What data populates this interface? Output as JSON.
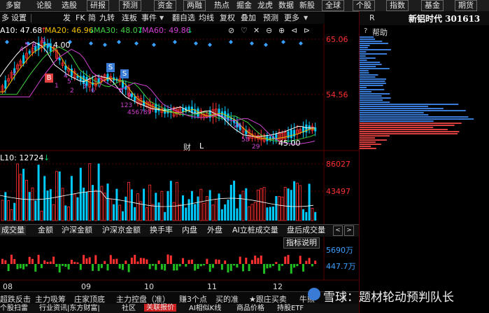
{
  "topbar": {
    "items": [
      "多窗",
      "论股",
      "选股"
    ],
    "boxed_items": [
      "研报",
      "预测",
      "资金",
      "两融",
      "热点",
      "掘金",
      "龙虎",
      "数据",
      "新股",
      "全球",
      "个股",
      "指数",
      "基金",
      "期货"
    ]
  },
  "toolbar": {
    "items": [
      "多",
      "设置",
      "发",
      "FK",
      "简",
      "九转",
      "连板",
      "事件"
    ],
    "items_right": [
      "翻自选",
      "均线",
      "复权",
      "叠加",
      "预测",
      "更多"
    ],
    "icons": [
      "dropdown-arrow-icon",
      "no-entry-icon",
      "heart-icon",
      "x-icon",
      "zoom-out-icon",
      "zoom-in-icon",
      "left-arrow-icon",
      "right-arrow-icon"
    ]
  },
  "ma_legend": [
    {
      "label": "A10: 47.68",
      "color": "#ffffff",
      "arrow": "↑"
    },
    {
      "label": "MA20: 46.96",
      "color": "#f0c000",
      "arrow": "↓"
    },
    {
      "label": "MA30: 48.07",
      "color": "#40d040",
      "arrow": "↓"
    },
    {
      "label": "MA60: 49.86",
      "color": "#d040d0",
      "arrow": "↓"
    }
  ],
  "price_axis": [
    "65.06",
    "54.56"
  ],
  "annotations": {
    "high_price": "4.00",
    "low_price": "45.00",
    "badge_b": "B",
    "badge_s1": "S",
    "badge_s2": "S",
    "cai": "财",
    "l_mark": "L",
    "seq_labels": [
      "4",
      "5",
      "8",
      "9",
      "2",
      "4",
      "5",
      "1",
      "2",
      "3",
      "6",
      "7",
      "8",
      "9",
      "123",
      "456789",
      "58",
      "29",
      "26"
    ]
  },
  "volume": {
    "label": "L10: 12724",
    "label_arrow": "↓",
    "axis": [
      "86027",
      "43497"
    ]
  },
  "indicator_tabs": [
    "成交量",
    "金额",
    "沪深金额",
    "沪深京金额",
    "换手率",
    "内盘",
    "外盘",
    "AI立桩成交量",
    "盘后成交量"
  ],
  "indicator_help": "指标说明",
  "flow_axis": [
    "5690万",
    "447.7万"
  ],
  "months": [
    "08",
    "09",
    "10",
    "11",
    "12"
  ],
  "bottom_tabs": [
    "个股扫雷",
    "行业资讯|东方财富|",
    "社区",
    "关联报价",
    "AI相似K线",
    "商品价格",
    "持股ETF"
  ],
  "bottom_tabs_left": [
    "超跌反击",
    "主力吸筹",
    "庄家顶底",
    "主力控盘（准）",
    "赚3个点",
    "买的准",
    "★跟庄买卖",
    "牛熊"
  ],
  "right_panel": {
    "r_label": "R",
    "stock_name": "新铝时代 301613",
    "help": "帮助"
  },
  "watermark": "雪球：题材轮动预判队长",
  "colors": {
    "up": "#ff3030",
    "down": "#00ccff",
    "ma_white": "#ffffff",
    "ma_yellow": "#f0c000",
    "ma_green": "#40d040",
    "ma_magenta": "#d040d0",
    "accent_red": "#cc2020"
  }
}
